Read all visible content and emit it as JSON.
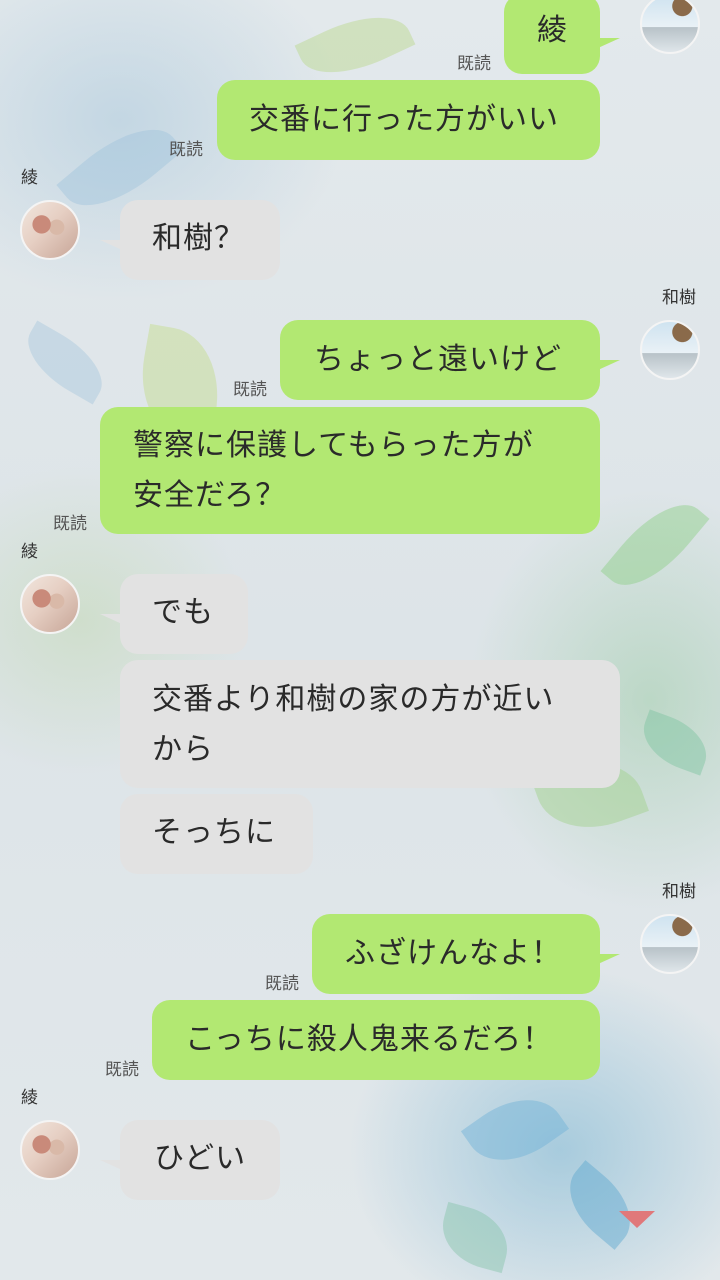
{
  "messages": [
    {
      "from": "kazuki",
      "text": "綾"
    },
    {
      "from": "kazuki",
      "text": "交番に行った方がいい",
      "read": "既読"
    },
    {
      "from": "aya",
      "sender": "綾",
      "text": "和樹？",
      "read": "既読"
    },
    {
      "from": "kazuki",
      "sender": "和樹",
      "text": "ちょっと遠いけど"
    },
    {
      "from": "kazuki",
      "text_line1": "警察に保護してもらった方が",
      "text_line2": "安全だろ？",
      "read": "既読"
    },
    {
      "from": "aya",
      "sender": "綾",
      "text": "でも",
      "read": "既読"
    },
    {
      "from": "aya",
      "text_line1": "交番より和樹の家の方が近い",
      "text_line2": "から"
    },
    {
      "from": "aya",
      "text": "そっちに"
    },
    {
      "from": "kazuki",
      "sender": "和樹",
      "text": "ふざけんなよ！"
    },
    {
      "from": "kazuki",
      "text": "こっちに殺人鬼来るだろ！",
      "read": "既読"
    }
  ],
  "read_labels": [
    "既読",
    "既読",
    "既読",
    "既読",
    "既読",
    "既読"
  ],
  "last_message": {
    "from": "aya",
    "sender": "綾",
    "text": "ひどい"
  },
  "colors": {
    "outgoing": "#b2e872",
    "incoming": "#e2e2e2",
    "scroll_arrow": "#e0787a"
  },
  "icons": {
    "scroll": "triangle-down-icon"
  }
}
